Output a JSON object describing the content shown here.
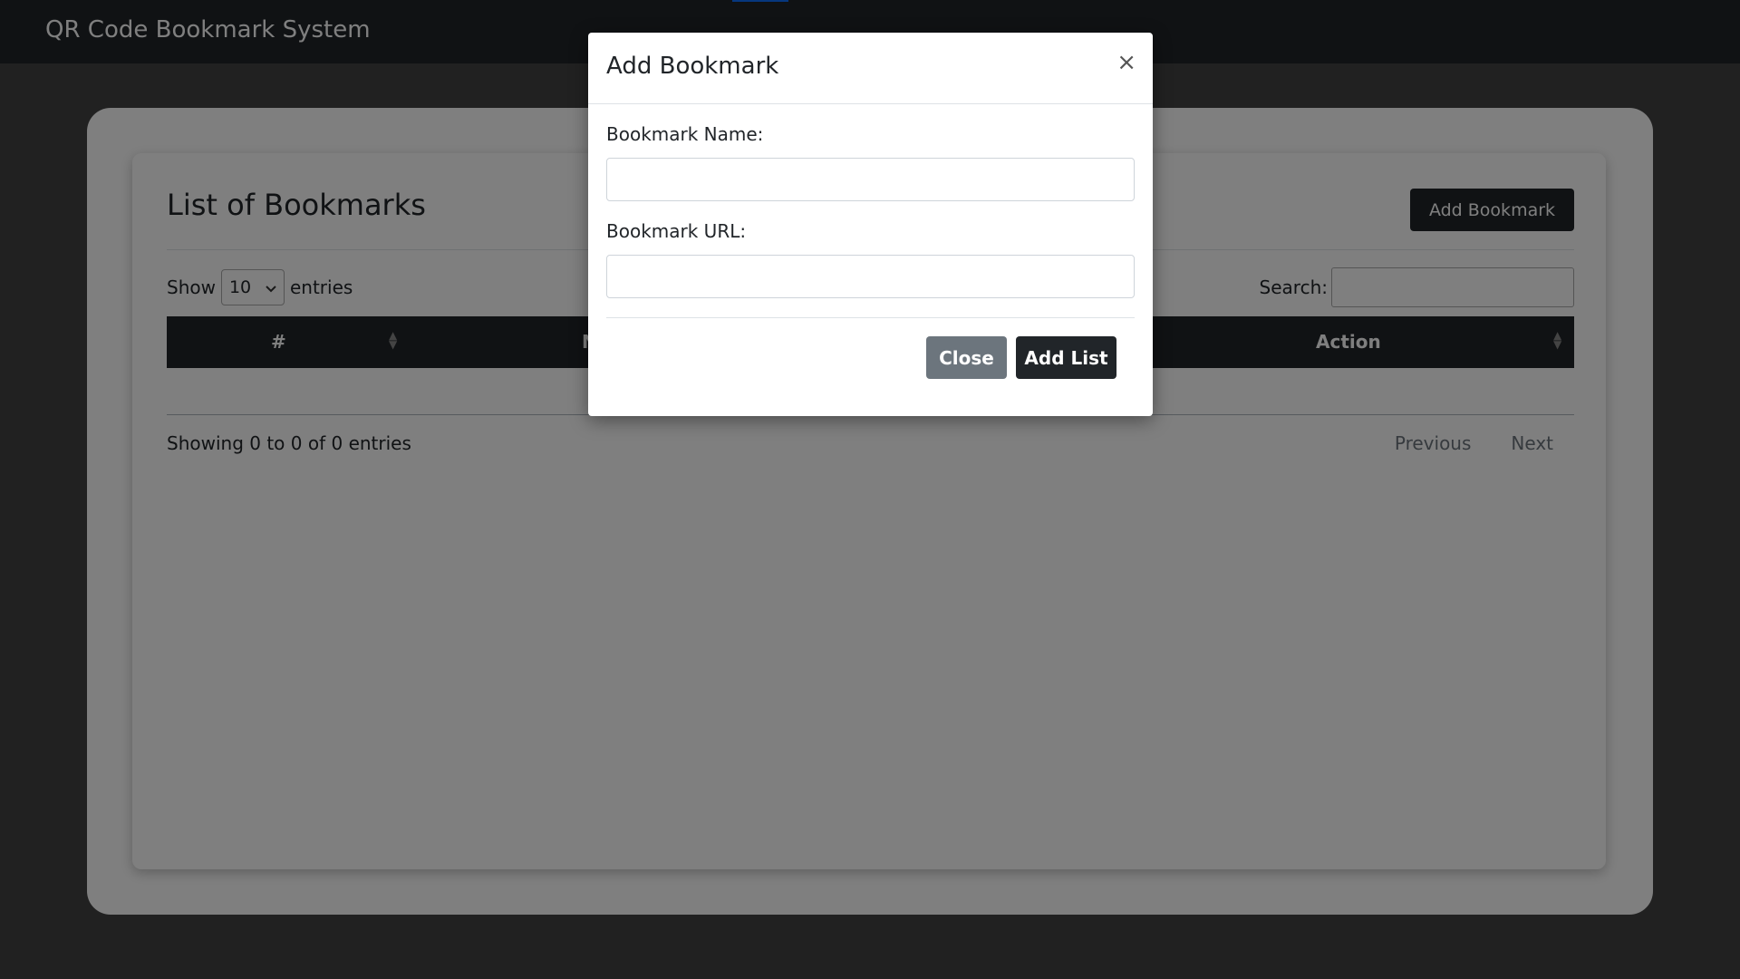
{
  "app": {
    "title": "QR Code Bookmark System"
  },
  "card": {
    "title": "List of Bookmarks",
    "add_button_label": "Add Bookmark"
  },
  "table": {
    "show_label": "Show",
    "entries_value": "10",
    "entries_label": "entries",
    "search_label": "Search:",
    "columns": [
      "#",
      "N",
      "Action"
    ],
    "info": "Showing 0 to 0 of 0 entries",
    "prev_label": "Previous",
    "next_label": "Next"
  },
  "modal": {
    "title": "Add Bookmark",
    "close_symbol": "×",
    "name_label": "Bookmark Name:",
    "url_label": "Bookmark URL:",
    "close_button": "Close",
    "submit_button": "Add List"
  },
  "colors": {
    "navbar": "#212529",
    "close_button": "#6c757d",
    "primary_dark": "#212529"
  }
}
